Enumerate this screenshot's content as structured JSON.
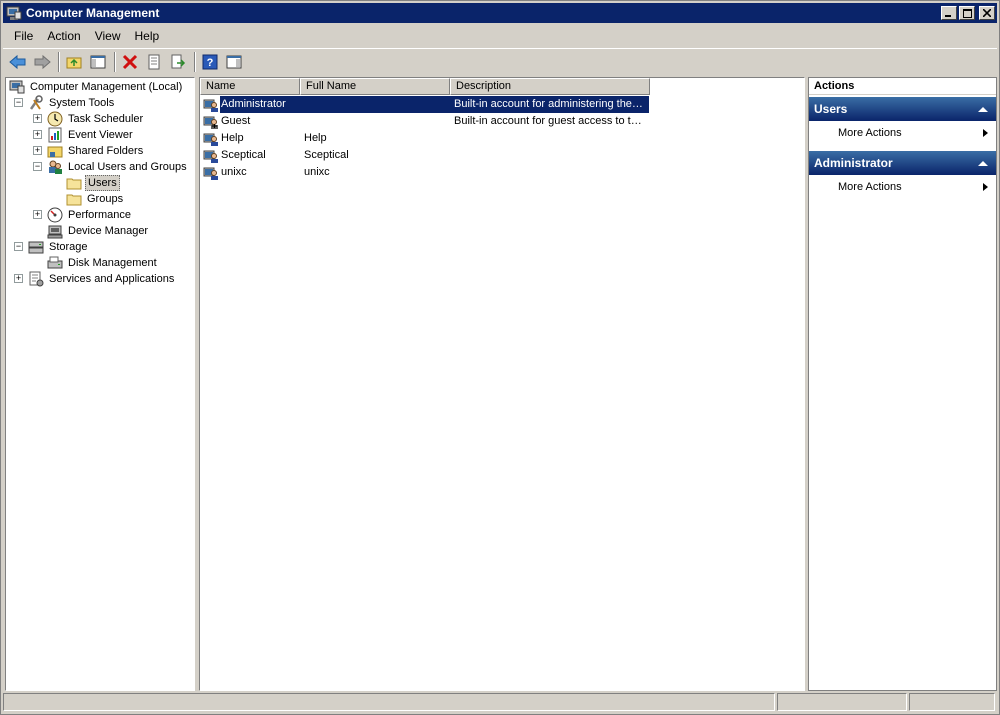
{
  "window": {
    "title": "Computer Management"
  },
  "menu": [
    "File",
    "Action",
    "View",
    "Help"
  ],
  "tree": {
    "root": "Computer Management (Local)",
    "system_tools": "System Tools",
    "task_scheduler": "Task Scheduler",
    "event_viewer": "Event Viewer",
    "shared_folders": "Shared Folders",
    "local_users": "Local Users and Groups",
    "users": "Users",
    "groups": "Groups",
    "performance": "Performance",
    "device_manager": "Device Manager",
    "storage": "Storage",
    "disk_management": "Disk Management",
    "services": "Services and Applications"
  },
  "list": {
    "columns": [
      "Name",
      "Full Name",
      "Description"
    ],
    "rows": [
      {
        "name": "Administrator",
        "full_name": "",
        "description": "Built-in account for administering the…"
      },
      {
        "name": "Guest",
        "full_name": "",
        "description": "Built-in account for guest access to t…"
      },
      {
        "name": "Help",
        "full_name": "Help",
        "description": ""
      },
      {
        "name": "Sceptical",
        "full_name": "Sceptical",
        "description": ""
      },
      {
        "name": "unixc",
        "full_name": "unixc",
        "description": ""
      }
    ]
  },
  "actions": {
    "title": "Actions",
    "groups": [
      {
        "header": "Users",
        "item": "More Actions"
      },
      {
        "header": "Administrator",
        "item": "More Actions"
      }
    ]
  },
  "colors": {
    "titlebar": "#0a246a",
    "selection": "#0a246a",
    "face": "#d4d0c8"
  }
}
